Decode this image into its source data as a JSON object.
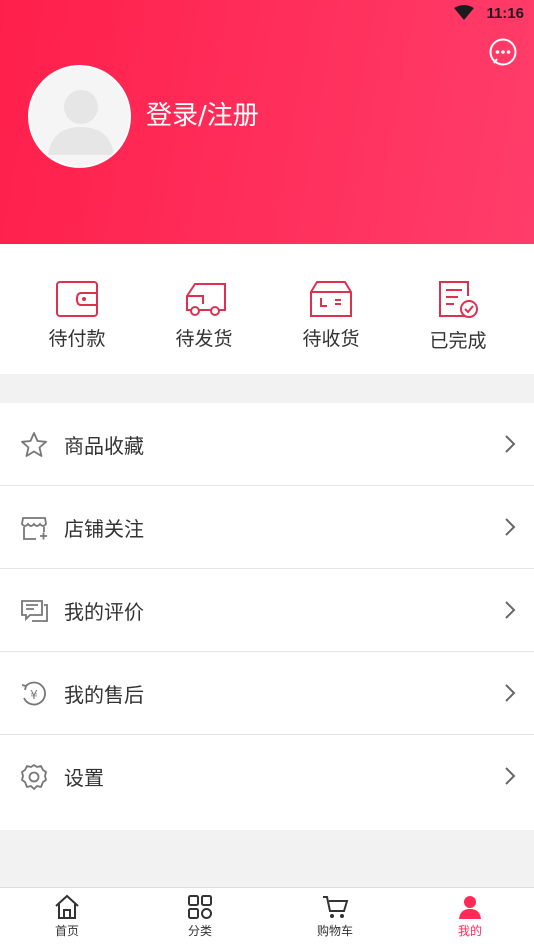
{
  "status_bar": {
    "time": "11:16"
  },
  "profile": {
    "login_label": "登录/注册"
  },
  "orders": [
    {
      "label": "待付款",
      "icon": "wallet-icon"
    },
    {
      "label": "待发货",
      "icon": "truck-icon"
    },
    {
      "label": "待收货",
      "icon": "package-icon"
    },
    {
      "label": "已完成",
      "icon": "completed-icon"
    }
  ],
  "menu": [
    {
      "label": "商品收藏",
      "icon": "star-icon"
    },
    {
      "label": "店铺关注",
      "icon": "store-icon"
    },
    {
      "label": "我的评价",
      "icon": "comment-icon"
    },
    {
      "label": "我的售后",
      "icon": "refund-icon"
    },
    {
      "label": "设置",
      "icon": "gear-icon"
    }
  ],
  "tabbar": [
    {
      "label": "首页",
      "icon": "home-icon"
    },
    {
      "label": "分类",
      "icon": "category-icon"
    },
    {
      "label": "购物车",
      "icon": "cart-icon"
    },
    {
      "label": "我的",
      "icon": "user-icon"
    }
  ],
  "colors": {
    "accent": "#ff2a55",
    "order_icon": "#e0304f"
  }
}
